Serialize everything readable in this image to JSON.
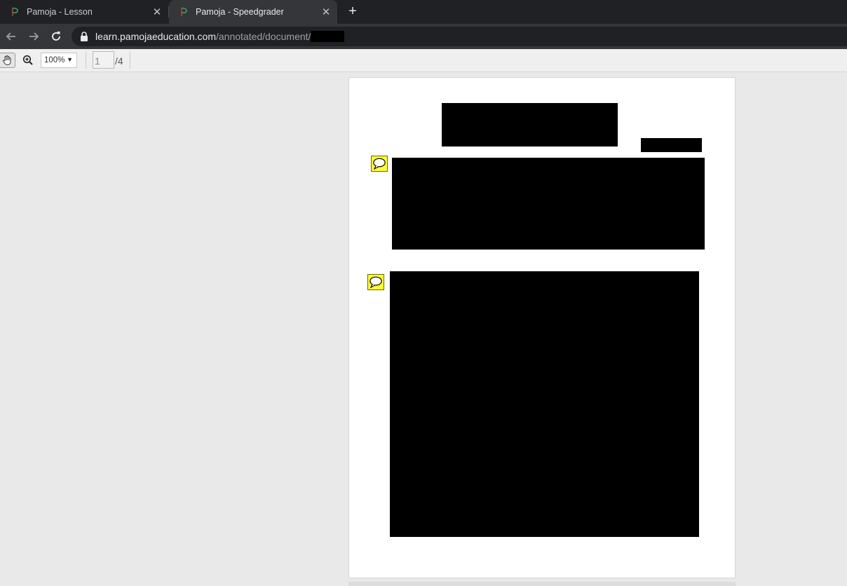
{
  "browser": {
    "tabs": [
      {
        "title": "Pamoja - Lesson",
        "active": false,
        "favicon": "pamoja-logo-icon"
      },
      {
        "title": "Pamoja - Speedgrader",
        "active": true,
        "favicon": "pamoja-logo-icon"
      }
    ],
    "new_tab_label": "+",
    "close_label": "✕",
    "url": {
      "host": "learn.pamojaeducation.com",
      "path": "/annotated/document/"
    }
  },
  "viewer": {
    "zoom": "100%",
    "zoom_arrow": "▼",
    "page_current": "1",
    "page_total": "/4"
  },
  "colors": {
    "chrome_dark": "#202124",
    "chrome_toolbar": "#35363a",
    "comment_yellow": "#ffff33",
    "redaction": "#000000"
  }
}
